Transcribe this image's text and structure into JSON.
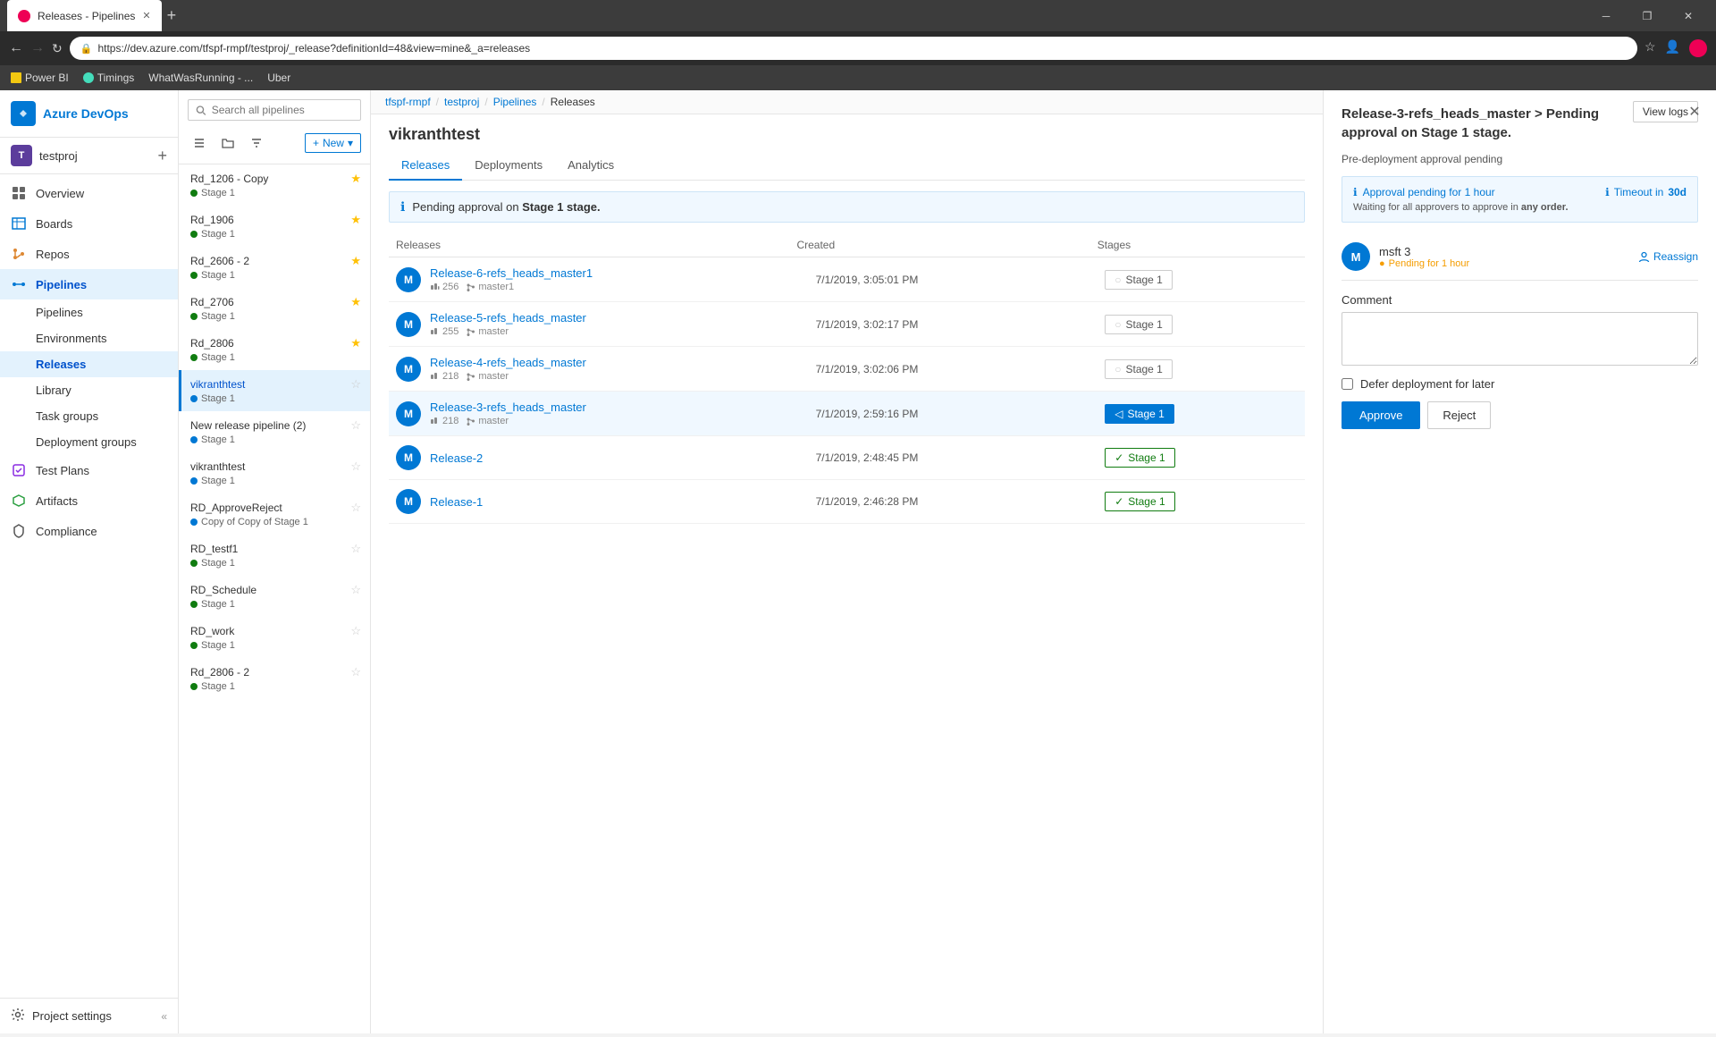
{
  "browser": {
    "tab_title": "Releases - Pipelines",
    "tab_favicon": "R",
    "url": "https://dev.azure.com/tfspf-rmpf/testproj/_release?definitionId=48&view=mine&_a=releases",
    "bookmarks": [
      "Power BI",
      "Timings",
      "WhatWasRunning - ...",
      "Uber"
    ],
    "win_minimize": "─",
    "win_restore": "❐",
    "win_close": "✕"
  },
  "sidebar": {
    "org_name": "Azure DevOps",
    "project_icon": "T",
    "project_name": "testproj",
    "nav_items": [
      {
        "id": "overview",
        "label": "Overview"
      },
      {
        "id": "boards",
        "label": "Boards"
      },
      {
        "id": "repos",
        "label": "Repos"
      },
      {
        "id": "pipelines",
        "label": "Pipelines"
      },
      {
        "id": "releases",
        "label": "Releases"
      },
      {
        "id": "library",
        "label": "Library"
      },
      {
        "id": "task-groups",
        "label": "Task groups"
      },
      {
        "id": "deployment-groups",
        "label": "Deployment groups"
      },
      {
        "id": "test-plans",
        "label": "Test Plans"
      },
      {
        "id": "artifacts",
        "label": "Artifacts"
      },
      {
        "id": "compliance",
        "label": "Compliance"
      }
    ],
    "footer": {
      "label": "Project settings"
    }
  },
  "pipeline_list": {
    "search_placeholder": "Search all pipelines",
    "new_button": "New",
    "items": [
      {
        "id": 1,
        "name": "Rd_1206 - Copy",
        "stage": "Stage 1",
        "stage_type": "green",
        "starred": true
      },
      {
        "id": 2,
        "name": "Rd_1906",
        "stage": "Stage 1",
        "stage_type": "green",
        "starred": true
      },
      {
        "id": 3,
        "name": "Rd_2606 - 2",
        "stage": "Stage 1",
        "stage_type": "green",
        "starred": true
      },
      {
        "id": 4,
        "name": "Rd_2706",
        "stage": "Stage 1",
        "stage_type": "green",
        "starred": true
      },
      {
        "id": 5,
        "name": "Rd_2806",
        "stage": "Stage 1",
        "stage_type": "green",
        "starred": true
      },
      {
        "id": 6,
        "name": "vikranthtest",
        "stage": "Stage 1",
        "stage_type": "info",
        "starred": false,
        "active": true
      },
      {
        "id": 7,
        "name": "New release pipeline (2)",
        "stage": "Stage 1",
        "stage_type": "info",
        "starred": false
      },
      {
        "id": 8,
        "name": "vikranthtest",
        "stage": "Stage 1",
        "stage_type": "info",
        "starred": false
      },
      {
        "id": 9,
        "name": "RD_ApproveReject",
        "stage": "Copy of Copy of Stage 1",
        "stage_type": "info",
        "starred": false
      },
      {
        "id": 10,
        "name": "RD_testf1",
        "stage": "Stage 1",
        "stage_type": "green",
        "starred": false
      },
      {
        "id": 11,
        "name": "RD_Schedule",
        "stage": "Stage 1",
        "stage_type": "green",
        "starred": false
      },
      {
        "id": 12,
        "name": "RD_work",
        "stage": "Stage 1",
        "stage_type": "green",
        "starred": false
      },
      {
        "id": 13,
        "name": "Rd_2806 - 2",
        "stage": "Stage 1",
        "stage_type": "green",
        "starred": false
      }
    ]
  },
  "breadcrumb": {
    "parts": [
      "tfspf-rmpf",
      "testproj",
      "Pipelines",
      "Releases"
    ]
  },
  "main": {
    "title": "vikranthtest",
    "tabs": [
      {
        "id": "releases",
        "label": "Releases",
        "active": true
      },
      {
        "id": "deployments",
        "label": "Deployments"
      },
      {
        "id": "analytics",
        "label": "Analytics"
      }
    ],
    "info_banner": {
      "text_prefix": "Pending approval on ",
      "stage": "Stage 1 stage.",
      "icon": "ℹ"
    },
    "table": {
      "headers": [
        "Releases",
        "Created",
        "Stages"
      ],
      "rows": [
        {
          "id": 1,
          "avatar": "M",
          "name": "Release-6-refs_heads_master1",
          "meta_count": "256",
          "meta_branch": "master1",
          "created": "7/1/2019, 3:05:01 PM",
          "stage": "Stage 1",
          "stage_type": "empty"
        },
        {
          "id": 2,
          "avatar": "M",
          "name": "Release-5-refs_heads_master",
          "meta_count": "255",
          "meta_branch": "master",
          "created": "7/1/2019, 3:02:17 PM",
          "stage": "Stage 1",
          "stage_type": "empty"
        },
        {
          "id": 3,
          "avatar": "M",
          "name": "Release-4-refs_heads_master",
          "meta_count": "218",
          "meta_branch": "master",
          "created": "7/1/2019, 3:02:06 PM",
          "stage": "Stage 1",
          "stage_type": "empty"
        },
        {
          "id": 4,
          "avatar": "M",
          "name": "Release-3-refs_heads_master",
          "meta_count": "218",
          "meta_branch": "master",
          "created": "7/1/2019, 2:59:16 PM",
          "stage": "Stage 1",
          "stage_type": "pending"
        },
        {
          "id": 5,
          "avatar": "M",
          "name": "Release-2",
          "meta_count": "",
          "meta_branch": "",
          "created": "7/1/2019, 2:48:45 PM",
          "stage": "Stage 1",
          "stage_type": "success"
        },
        {
          "id": 6,
          "avatar": "M",
          "name": "Release-1",
          "meta_count": "",
          "meta_branch": "",
          "created": "7/1/2019, 2:46:28 PM",
          "stage": "Stage 1",
          "stage_type": "success"
        }
      ]
    }
  },
  "right_panel": {
    "title": "Release-3-refs_heads_master > Pending approval on Stage 1 stage.",
    "subtitle": "Pre-deployment approval pending",
    "view_logs_btn": "View logs",
    "approval_box": {
      "title": "Approval pending for 1 hour",
      "subtitle_prefix": "Waiting for all approvers to approve in ",
      "subtitle_bold": "any order.",
      "timeout_label": "Timeout in",
      "timeout_value": "30d"
    },
    "approver": {
      "avatar": "M",
      "name": "msft 3",
      "status": "Pending for 1 hour"
    },
    "reassign_label": "Reassign",
    "comment_label": "Comment",
    "comment_placeholder": "",
    "defer_label": "Defer deployment for later",
    "approve_btn": "Approve",
    "reject_btn": "Reject"
  }
}
